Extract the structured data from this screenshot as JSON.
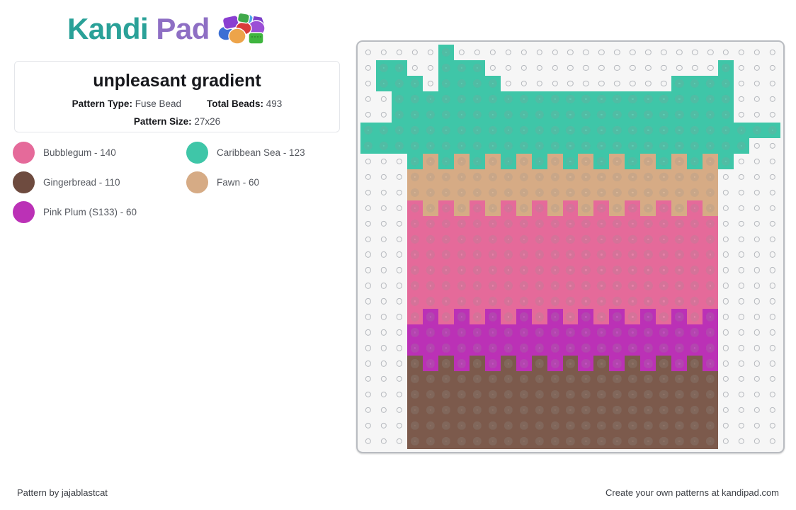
{
  "brand": {
    "name_part1": "Kandi",
    "name_part2": "Pad",
    "icon": "beads-icon",
    "color_teal": "#2aa198",
    "color_purple": "#8e6fc4"
  },
  "info": {
    "title": "unpleasant gradient",
    "pattern_type_label": "Pattern Type:",
    "pattern_type_value": "Fuse Bead",
    "total_beads_label": "Total Beads:",
    "total_beads_value": "493",
    "pattern_size_label": "Pattern Size:",
    "pattern_size_value": "27x26"
  },
  "legend": [
    {
      "name": "Bubblegum",
      "count": "140",
      "label": "Bubblegum - 140",
      "color": "#e56a9a",
      "key": "P"
    },
    {
      "name": "Caribbean Sea",
      "count": "123",
      "label": "Caribbean Sea - 123",
      "color": "#3fc6a8",
      "key": "T"
    },
    {
      "name": "Gingerbread",
      "count": "110",
      "label": "Gingerbread - 110",
      "color": "#6e4b3f",
      "key": "G"
    },
    {
      "name": "Fawn",
      "count": "60",
      "label": "Fawn - 60",
      "color": "#d6ab85",
      "key": "F"
    },
    {
      "name": "Pink Plum (S133)",
      "count": "60",
      "label": "Pink Plum (S133) - 60",
      "color": "#bb31b6",
      "key": "M"
    }
  ],
  "board": {
    "columns": 27,
    "rows": 26,
    "empty_color": "#f6f6f6",
    "palette": {
      "T": "#3fc6a8",
      "F": "#d6ab85",
      "P": "#e56a9a",
      "M": "#bb31b6",
      "G": "#7c5a4c",
      ".": null
    },
    "rows_data": [
      ".....T.....................",
      ".TT..TTT...............T...",
      ".TTT.TTTT...........TTTT...",
      "..TTTTTTTTTTTTTTTTTTTTTT...",
      "..TTTTTTTTTTTTTTTTTTTTTT...",
      "TTTTTTTTTTTTTTTTTTTTTTTTTTT",
      "TTTTTTTTTTTTTTTTTTTTTTTTT..",
      "...TFTFTFTFTFTFTFTFTFTFT...",
      "...FFFFFFFFFFFFFFFFFFFF....",
      "...FFFFFFFFFFFFFFFFFFFF....",
      "...PFPFPFPFPFPFPFPFPFPF....",
      "...PPPPPPPPPPPPPPPPPPPP....",
      "...PPPPPPPPPPPPPPPPPPPP....",
      "...PPPPPPPPPPPPPPPPPPPP....",
      "...PPPPPPPPPPPPPPPPPPPP....",
      "...PPPPPPPPPPPPPPPPPPPP....",
      "...PPPPPPPPPPPPPPPPPPPP....",
      "...PMPMPMPMPMPMPMPMPMPM....",
      "...MMMMMMMMMMMMMMMMMMMM....",
      "...MMMMMMMMMMMMMMMMMMMM....",
      "...GMGMGMGMGMGMGMGMGMGM....",
      "...GGGGGGGGGGGGGGGGGGGG....",
      "...GGGGGGGGGGGGGGGGGGGG....",
      "...GGGGGGGGGGGGGGGGGGGG....",
      "...GGGGGGGGGGGGGGGGGGGG....",
      "...GGGGGGGGGGGGGGGGGGGG...."
    ]
  },
  "footer": {
    "left": "Pattern by jajablastcat",
    "right": "Create your own patterns at kandipad.com"
  }
}
